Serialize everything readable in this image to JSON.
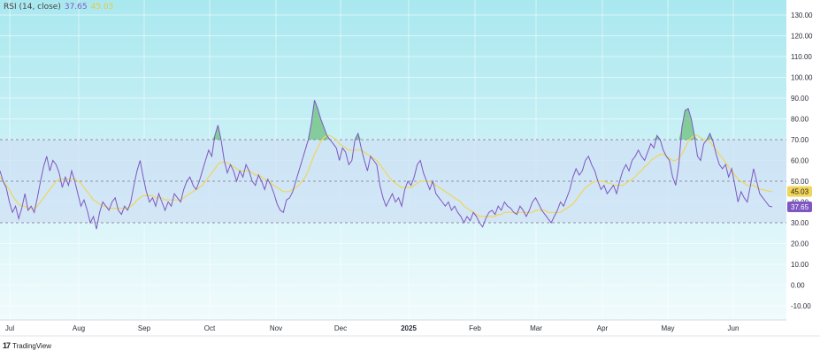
{
  "legend": {
    "name": "RSI (14, close)",
    "rsi_value": "37.65",
    "ma_value": "45.03"
  },
  "brand": {
    "logo": "17",
    "name": "TradingView"
  },
  "colors": {
    "rsi_line": "#7e57c2",
    "ma_line": "#f0d55a",
    "band_fill": "#cfe0f5",
    "overbought_fill": "#4caf50",
    "background_top": "#a9e8ef",
    "background_bottom": "#f1fbfd",
    "rsi_badge": "#7e57c2",
    "ma_badge": "#f0d55a"
  },
  "chart_data": {
    "type": "line",
    "y_axis": {
      "range": [
        -10,
        130
      ],
      "ticks": [
        "130.00",
        "120.00",
        "110.00",
        "100.00",
        "90.00",
        "80.00",
        "70.00",
        "60.00",
        "50.00",
        "40.00",
        "30.00",
        "20.00",
        "10.00",
        "0.00",
        "-10.00"
      ]
    },
    "bands": {
      "upper": 70,
      "middle": 50,
      "lower": 30
    },
    "x_axis": {
      "labels": [
        "Jul",
        "Aug",
        "Sep",
        "Oct",
        "Nov",
        "Dec",
        "2025",
        "Feb",
        "Mar",
        "Apr",
        "May",
        "Jun"
      ]
    },
    "series": [
      {
        "values": [
          55,
          50,
          47,
          40,
          35,
          38,
          32,
          37,
          44,
          36,
          38,
          35,
          42,
          50,
          57,
          62,
          55,
          60,
          58,
          54,
          47,
          52,
          48,
          55,
          50,
          44,
          38,
          41,
          36,
          30,
          33,
          27,
          35,
          40,
          38,
          36,
          40,
          42,
          36,
          34,
          38,
          36,
          40,
          48,
          55,
          60,
          52,
          45,
          40,
          42,
          38,
          44,
          40,
          36,
          40,
          38,
          44,
          42,
          40,
          46,
          50,
          52,
          48,
          46,
          50,
          55,
          60,
          65,
          62,
          72,
          77,
          70,
          60,
          54,
          58,
          55,
          50,
          55,
          52,
          58,
          55,
          50,
          48,
          53,
          50,
          46,
          51,
          48,
          44,
          39,
          36,
          35,
          41,
          42,
          45,
          50,
          55,
          60,
          65,
          70,
          78,
          89,
          85,
          80,
          76,
          72,
          70,
          68,
          66,
          60,
          66,
          64,
          58,
          60,
          70,
          73,
          66,
          60,
          55,
          62,
          60,
          58,
          48,
          42,
          38,
          41,
          44,
          40,
          42,
          38,
          46,
          50,
          48,
          52,
          58,
          60,
          54,
          50,
          46,
          50,
          44,
          42,
          40,
          38,
          40,
          36,
          38,
          35,
          33,
          30,
          33,
          31,
          35,
          33,
          30,
          28,
          32,
          35,
          36,
          34,
          38,
          36,
          40,
          38,
          37,
          35,
          34,
          38,
          36,
          33,
          36,
          40,
          42,
          39,
          36,
          34,
          32,
          30,
          33,
          36,
          40,
          38,
          42,
          46,
          52,
          56,
          53,
          55,
          60,
          62,
          58,
          55,
          50,
          46,
          48,
          44,
          46,
          48,
          44,
          50,
          55,
          58,
          55,
          60,
          62,
          65,
          62,
          60,
          64,
          68,
          66,
          72,
          70,
          65,
          62,
          60,
          52,
          48,
          58,
          76,
          84,
          85,
          80,
          72,
          62,
          60,
          68,
          70,
          73,
          69,
          63,
          58,
          56,
          58,
          52,
          56,
          48,
          40,
          45,
          42,
          40,
          48,
          56,
          50,
          44,
          42,
          40,
          38,
          37.65
        ]
      },
      {
        "values": [
          52,
          50,
          48,
          46,
          43,
          41,
          39,
          38,
          38,
          37,
          37,
          37,
          38,
          40,
          42,
          44,
          46,
          48,
          50,
          51,
          51,
          51,
          51,
          51,
          51,
          50,
          49,
          47,
          45,
          43,
          41,
          40,
          39,
          38,
          38,
          37,
          37,
          37,
          37,
          37,
          37,
          37,
          38,
          39,
          41,
          42,
          43,
          43,
          43,
          43,
          42,
          42,
          42,
          41,
          41,
          41,
          41,
          41,
          41,
          42,
          43,
          44,
          45,
          46,
          47,
          48,
          50,
          52,
          54,
          56,
          58,
          59,
          59,
          59,
          58,
          57,
          56,
          55,
          55,
          55,
          55,
          54,
          53,
          53,
          52,
          51,
          50,
          49,
          48,
          47,
          46,
          45,
          45,
          45,
          46,
          47,
          48,
          50,
          52,
          55,
          59,
          63,
          66,
          69,
          71,
          72,
          72,
          71,
          70,
          68,
          67,
          66,
          65,
          65,
          65,
          65,
          65,
          64,
          63,
          62,
          61,
          60,
          58,
          56,
          54,
          52,
          50,
          49,
          48,
          47,
          47,
          47,
          47,
          48,
          49,
          50,
          50,
          50,
          50,
          49,
          48,
          47,
          46,
          45,
          44,
          43,
          42,
          41,
          40,
          38,
          37,
          36,
          35,
          34,
          33,
          33,
          33,
          33,
          33,
          33,
          34,
          34,
          35,
          35,
          35,
          35,
          35,
          35,
          35,
          35,
          35,
          35,
          36,
          36,
          36,
          36,
          35,
          35,
          35,
          35,
          35,
          36,
          37,
          38,
          39,
          41,
          43,
          45,
          47,
          48,
          49,
          50,
          50,
          50,
          50,
          49,
          49,
          48,
          48,
          48,
          48,
          49,
          50,
          51,
          52,
          54,
          55,
          57,
          58,
          60,
          61,
          62,
          63,
          63,
          62,
          61,
          60,
          60,
          61,
          63,
          66,
          69,
          71,
          72,
          72,
          71,
          70,
          70,
          69,
          67,
          65,
          63,
          61,
          59,
          57,
          55,
          53,
          51,
          50,
          49,
          48,
          48,
          48,
          47,
          46,
          46,
          45.5,
          45.2,
          45.03
        ]
      }
    ],
    "markers": [
      {
        "value": "45.03",
        "series": 1
      },
      {
        "value": "37.65",
        "series": 0
      }
    ],
    "grid": true
  }
}
